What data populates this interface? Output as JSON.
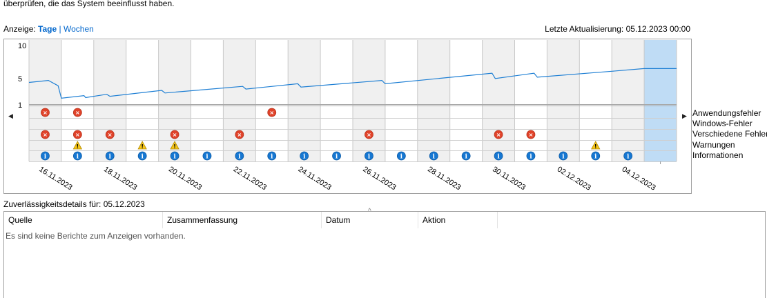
{
  "intro_text": "überprüfen, die das System beeinflusst haben.",
  "view": {
    "label": "Anzeige:",
    "days": "Tage",
    "separator": "|",
    "weeks": "Wochen"
  },
  "last_update": "Letzte Aktualisierung: 05.12.2023 00:00",
  "legend": [
    "Anwendungsfehler",
    "Windows-Fehler",
    "Verschiedene Fehler",
    "Warnungen",
    "Informationen"
  ],
  "chart_data": {
    "type": "line",
    "y_ticks": [
      "10",
      "5",
      "1"
    ],
    "ylim": [
      1,
      10
    ],
    "column_count": 20,
    "selected_column": 19,
    "x_labels": [
      "16.11.2023",
      "18.11.2023",
      "20.11.2023",
      "22.11.2023",
      "24.11.2023",
      "26.11.2023",
      "28.11.2023",
      "30.11.2023",
      "02.12.2023",
      "04.12.2023"
    ],
    "stability_index": [
      [
        0.0,
        4.4
      ],
      [
        0.6,
        4.7
      ],
      [
        0.9,
        3.9
      ],
      [
        1.0,
        2.0
      ],
      [
        1.7,
        2.4
      ],
      [
        1.75,
        2.1
      ],
      [
        2.4,
        2.6
      ],
      [
        2.5,
        2.3
      ],
      [
        4.1,
        3.2
      ],
      [
        4.2,
        2.8
      ],
      [
        6.6,
        3.8
      ],
      [
        6.7,
        3.4
      ],
      [
        8.3,
        4.2
      ],
      [
        8.4,
        3.7
      ],
      [
        10.9,
        4.7
      ],
      [
        11.0,
        4.2
      ],
      [
        14.3,
        5.8
      ],
      [
        14.4,
        5.0
      ],
      [
        15.6,
        5.8
      ],
      [
        15.7,
        5.2
      ],
      [
        18.0,
        6.1
      ],
      [
        19.0,
        6.5
      ],
      [
        20.0,
        6.5
      ]
    ],
    "events": {
      "application_errors": [
        0,
        1,
        7
      ],
      "windows_errors": [],
      "misc_errors": [
        0,
        1,
        2,
        4,
        6,
        10,
        14,
        15
      ],
      "warnings": [
        1,
        3,
        4,
        17
      ],
      "information": [
        0,
        1,
        2,
        3,
        4,
        5,
        6,
        7,
        8,
        9,
        10,
        11,
        12,
        13,
        14,
        15,
        16,
        17,
        18
      ]
    }
  },
  "details": {
    "title": "Zuverlässigkeitsdetails für: 05.12.2023",
    "columns": [
      "Quelle",
      "Zusammenfassung",
      "Datum",
      "Aktion"
    ],
    "empty_message": "Es sind keine Berichte zum Anzeigen vorhanden."
  }
}
